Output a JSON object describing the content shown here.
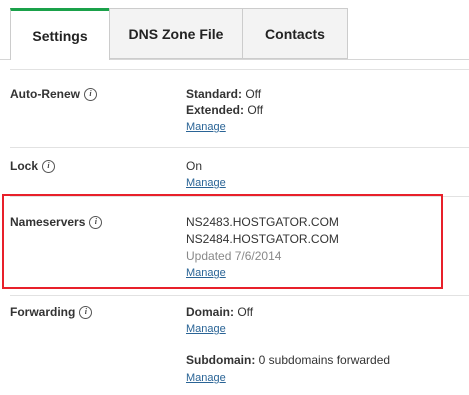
{
  "tabs": [
    {
      "label": "Settings",
      "active": true
    },
    {
      "label": "DNS Zone File",
      "active": false
    },
    {
      "label": "Contacts",
      "active": false
    }
  ],
  "settings": {
    "auto_renew": {
      "label": "Auto-Renew",
      "standard_key": "Standard:",
      "standard_value": " Off",
      "extended_key": "Extended:",
      "extended_value": " Off",
      "manage": "Manage"
    },
    "lock": {
      "label": "Lock",
      "value": "On",
      "manage": "Manage"
    },
    "nameservers": {
      "label": "Nameservers",
      "servers": [
        "NS2483.HOSTGATOR.COM",
        "NS2484.HOSTGATOR.COM"
      ],
      "updated": "Updated 7/6/2014",
      "manage": "Manage"
    },
    "forwarding": {
      "label": "Forwarding",
      "domain_key": "Domain:",
      "domain_value": " Off",
      "domain_manage": "Manage",
      "subdomain_key": "Subdomain:",
      "subdomain_value": " 0 subdomains forwarded",
      "subdomain_manage": "Manage"
    }
  },
  "colors": {
    "active_tab_accent": "#1aa14a",
    "highlight": "#e8202a",
    "link": "#2a6496"
  },
  "icons": [
    "info-icon"
  ]
}
